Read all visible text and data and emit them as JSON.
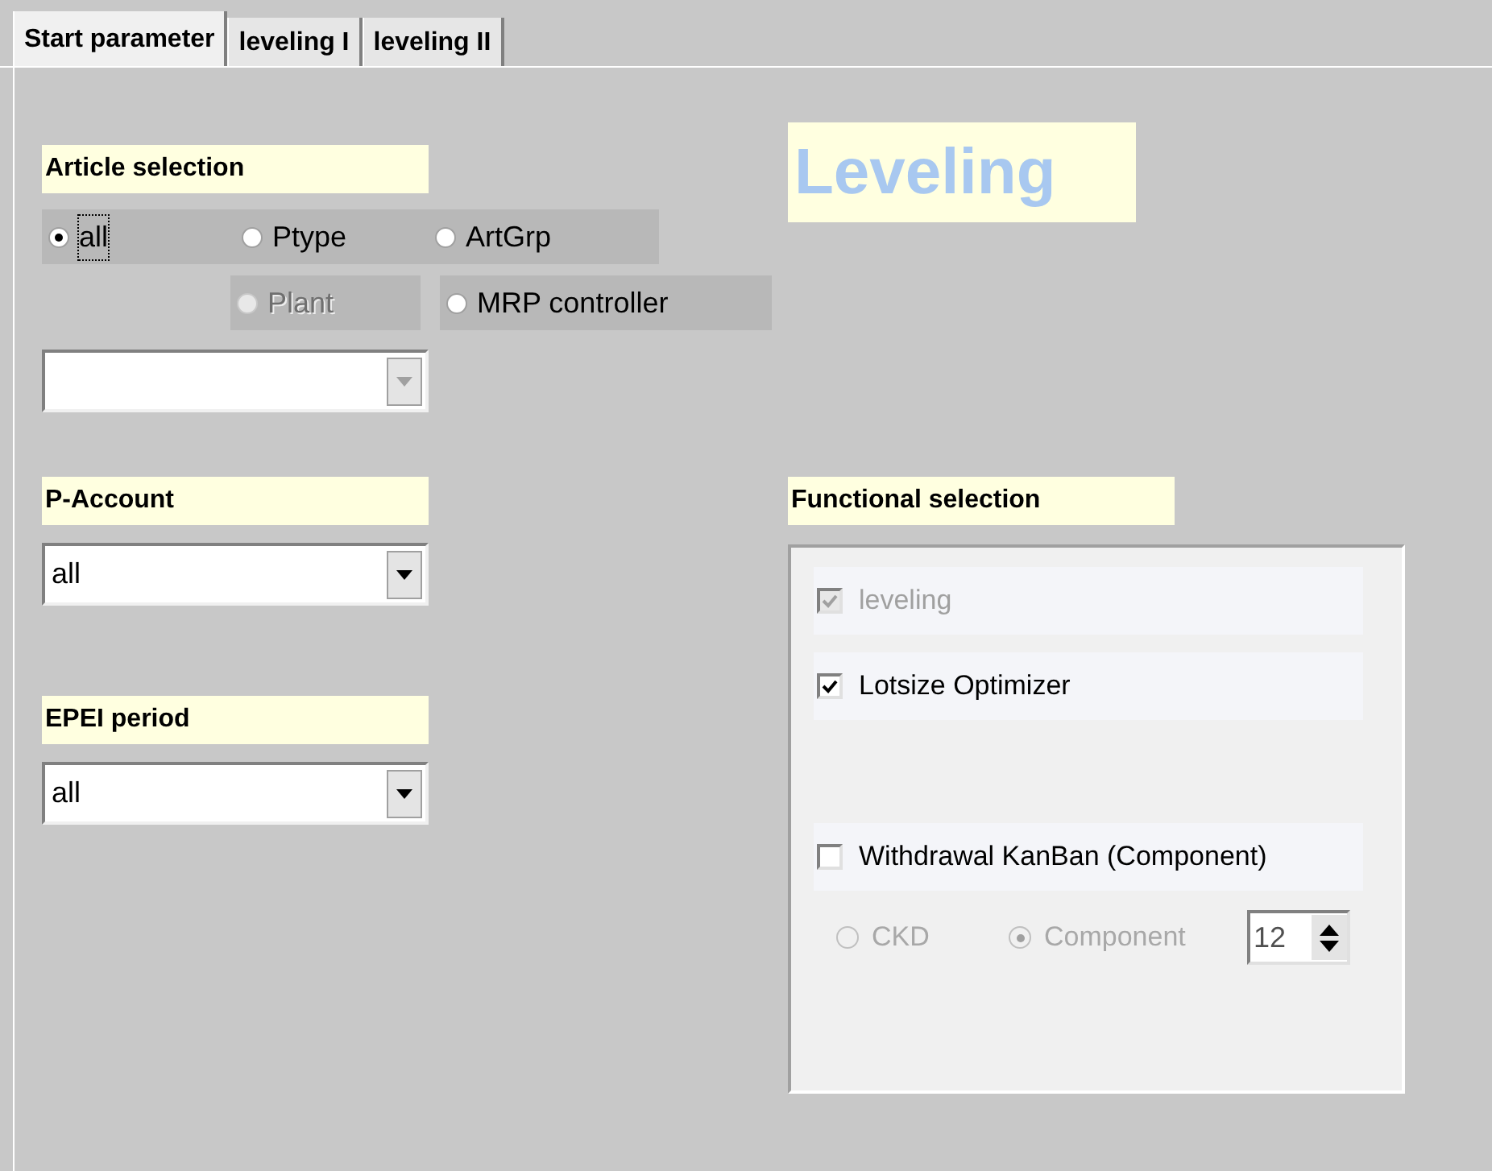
{
  "tabs": [
    {
      "label": "Start parameter",
      "selected": true
    },
    {
      "label": "leveling I",
      "selected": false
    },
    {
      "label": "leveling II",
      "selected": false
    }
  ],
  "title": "Leveling",
  "article_selection": {
    "label": "Article selection",
    "radio_rows": [
      [
        {
          "label": "all",
          "selected": true,
          "disabled": false
        },
        {
          "label": "Ptype",
          "selected": false,
          "disabled": false
        },
        {
          "label": "ArtGrp",
          "selected": false,
          "disabled": false
        }
      ],
      [
        {
          "label": "Plant",
          "selected": false,
          "disabled": true
        },
        {
          "label": "MRP controller",
          "selected": false,
          "disabled": false
        }
      ]
    ],
    "combo": {
      "disabled": true
    }
  },
  "p_account": {
    "label": "P-Account",
    "value": "all"
  },
  "epei_period": {
    "label": "EPEI period",
    "value": "all"
  },
  "functional_selection": {
    "label": "Functional selection",
    "checkboxes": [
      {
        "label": "leveling",
        "checked": true,
        "disabled": true
      },
      {
        "label": "Lotsize Optimizer",
        "checked": true,
        "disabled": false
      },
      {
        "label": "Withdrawal KanBan (Component)",
        "checked": false,
        "disabled": false
      }
    ],
    "radios": [
      {
        "label": "CKD",
        "selected": false,
        "disabled": true
      },
      {
        "label": "Component",
        "selected": true,
        "disabled": true
      }
    ],
    "spinner": {
      "value": "12"
    }
  }
}
